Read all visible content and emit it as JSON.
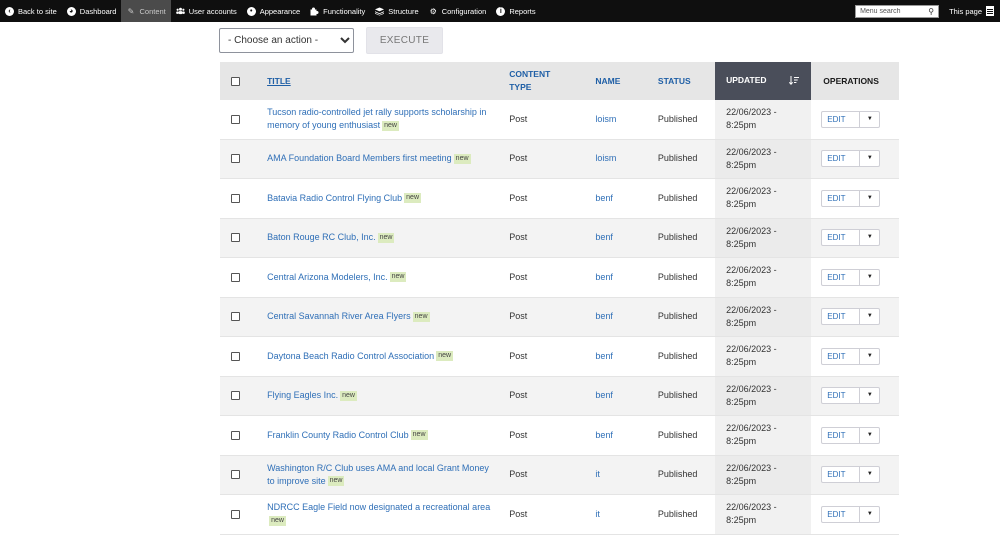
{
  "toolbar": {
    "back_to_site": "Back to site",
    "dashboard": "Dashboard",
    "content": "Content",
    "user_accounts": "User accounts",
    "appearance": "Appearance",
    "functionality": "Functionality",
    "structure": "Structure",
    "configuration": "Configuration",
    "reports": "Reports",
    "search_placeholder": "Menu search",
    "this_page": "This page"
  },
  "bulk": {
    "action_selected": "- Choose an action -",
    "execute_label": "EXECUTE"
  },
  "table": {
    "headers": {
      "title": "TITLE",
      "content_type_line1": "CONTENT",
      "content_type_line2": "TYPE",
      "name": "NAME",
      "status": "STATUS",
      "updated": "UPDATED",
      "operations": "OPERATIONS"
    },
    "badge_label": "new",
    "edit_label": "EDIT",
    "rows": [
      {
        "title": "Tucson radio-controlled jet rally supports scholarship in memory of young enthusiast",
        "type": "Post",
        "name": "loism",
        "status": "Published",
        "date": "22/06/2023 -",
        "time": "8:25pm"
      },
      {
        "title": "AMA Foundation Board Members first meeting",
        "type": "Post",
        "name": "loism",
        "status": "Published",
        "date": "22/06/2023 -",
        "time": "8:25pm"
      },
      {
        "title": "Batavia Radio Control Flying Club",
        "type": "Post",
        "name": "benf",
        "status": "Published",
        "date": "22/06/2023 -",
        "time": "8:25pm"
      },
      {
        "title": "Baton Rouge RC Club, Inc.",
        "type": "Post",
        "name": "benf",
        "status": "Published",
        "date": "22/06/2023 -",
        "time": "8:25pm"
      },
      {
        "title": "Central Arizona Modelers, Inc.",
        "type": "Post",
        "name": "benf",
        "status": "Published",
        "date": "22/06/2023 -",
        "time": "8:25pm"
      },
      {
        "title": "Central Savannah River Area Flyers",
        "type": "Post",
        "name": "benf",
        "status": "Published",
        "date": "22/06/2023 -",
        "time": "8:25pm"
      },
      {
        "title": "Daytona Beach Radio Control Association",
        "type": "Post",
        "name": "benf",
        "status": "Published",
        "date": "22/06/2023 -",
        "time": "8:25pm"
      },
      {
        "title": "Flying Eagles Inc.",
        "type": "Post",
        "name": "benf",
        "status": "Published",
        "date": "22/06/2023 -",
        "time": "8:25pm"
      },
      {
        "title": "Franklin County Radio Control Club",
        "type": "Post",
        "name": "benf",
        "status": "Published",
        "date": "22/06/2023 -",
        "time": "8:25pm"
      },
      {
        "title": "Washington R/C Club uses AMA and local Grant Money to improve site",
        "type": "Post",
        "name": "it",
        "status": "Published",
        "date": "22/06/2023 -",
        "time": "8:25pm"
      },
      {
        "title": "NDRCC Eagle Field now designated a recreational area",
        "type": "Post",
        "name": "it",
        "status": "Published",
        "date": "22/06/2023 -",
        "time": "8:25pm"
      }
    ]
  }
}
